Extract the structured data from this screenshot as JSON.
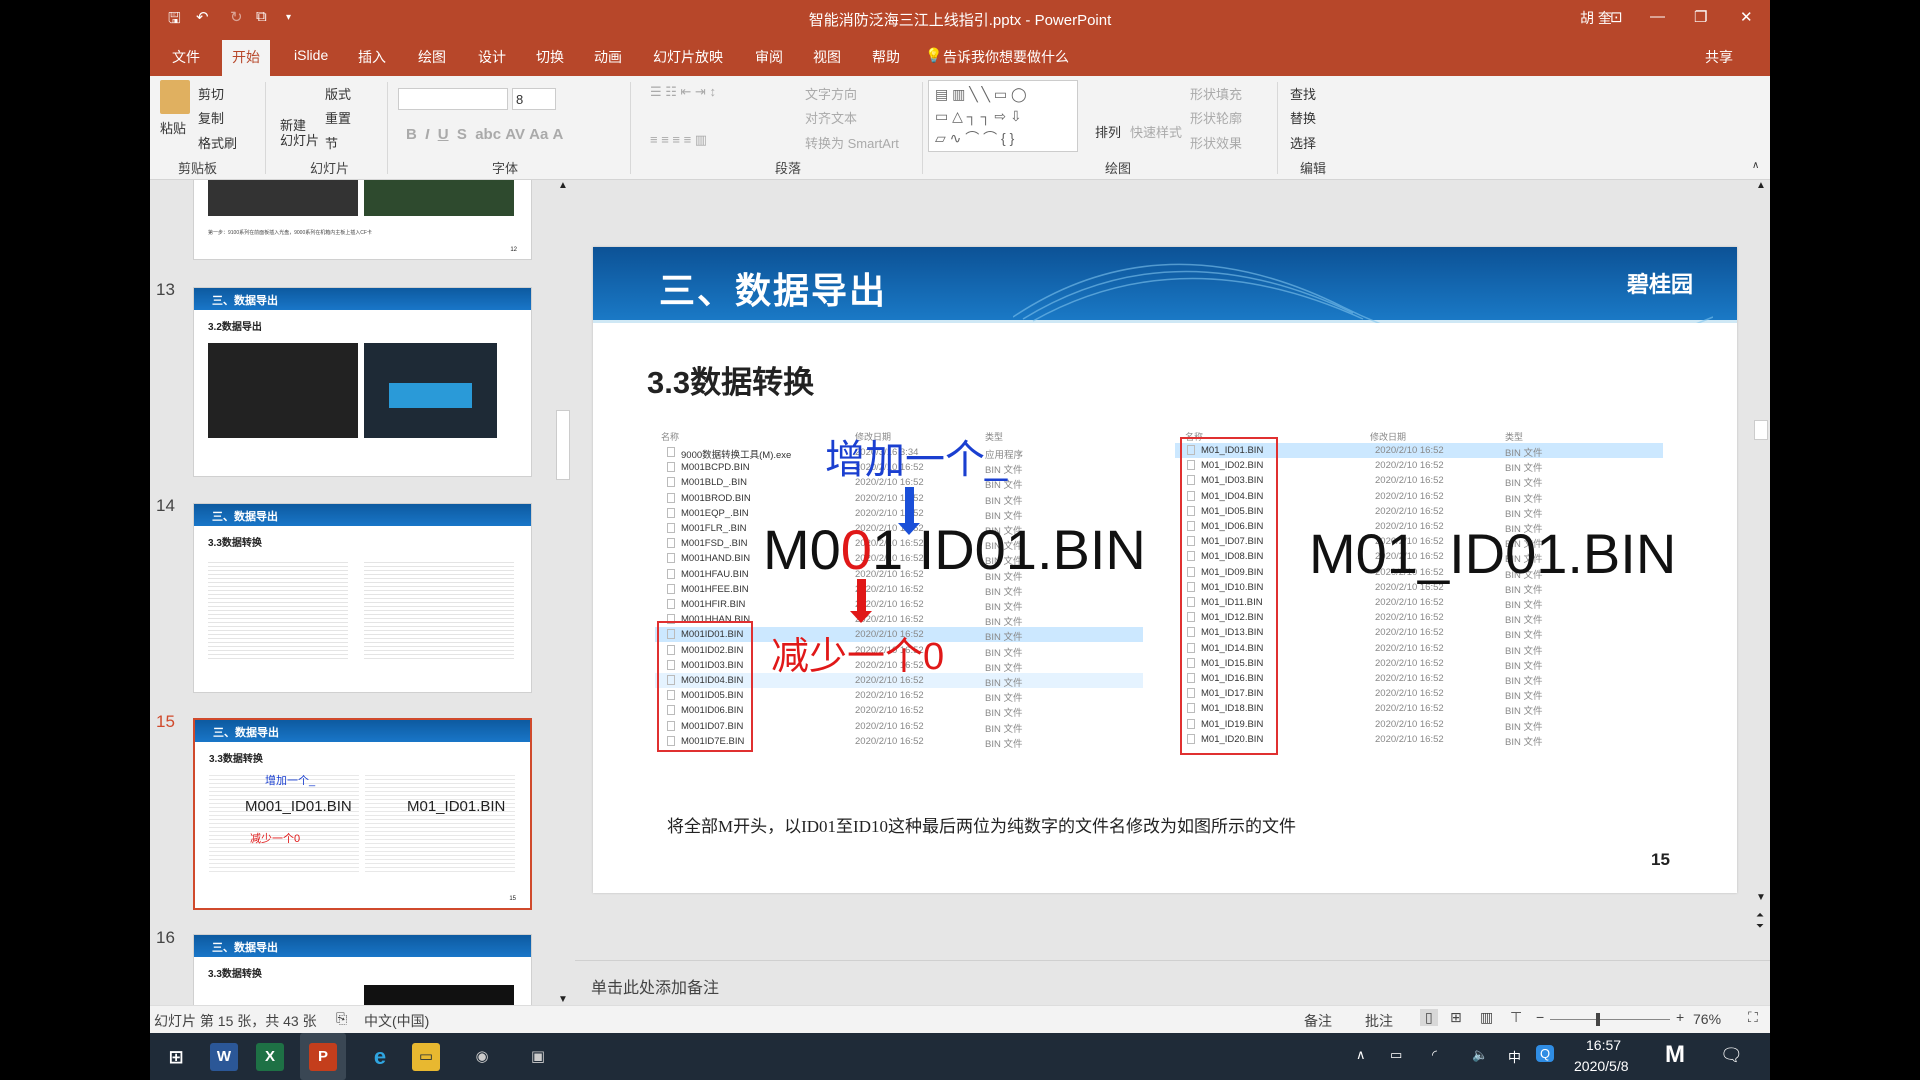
{
  "window": {
    "title": "智能消防泛海三江上线指引.pptx  -  PowerPoint",
    "user": "胡 奎",
    "controls": [
      "minimize",
      "restore",
      "close"
    ]
  },
  "tabs": [
    {
      "label": "文件"
    },
    {
      "label": "开始",
      "active": true
    },
    {
      "label": "iSlide"
    },
    {
      "label": "插入"
    },
    {
      "label": "绘图"
    },
    {
      "label": "设计"
    },
    {
      "label": "切换"
    },
    {
      "label": "动画"
    },
    {
      "label": "幻灯片放映"
    },
    {
      "label": "审阅"
    },
    {
      "label": "视图"
    },
    {
      "label": "帮助"
    }
  ],
  "tell_me": "告诉我你想要做什么",
  "share": "共享",
  "ribbon": {
    "clipboard": {
      "paste": "粘贴",
      "cut": "剪切",
      "copy": "复制",
      "format_painter": "格式刷",
      "group": "剪贴板"
    },
    "slides": {
      "new_slide": "新建\n幻灯片",
      "layout": "版式",
      "reset": "重置",
      "section": "节",
      "group": "幻灯片"
    },
    "font": {
      "font_size": "8",
      "group": "字体"
    },
    "paragraph": {
      "text_direction": "文字方向",
      "align_text": "对齐文本",
      "smartart": "转换为 SmartArt",
      "group": "段落"
    },
    "drawing": {
      "arrange": "排列",
      "quick_styles": "快速样式",
      "shape_fill": "形状填充",
      "shape_outline": "形状轮廓",
      "shape_effects": "形状效果",
      "group": "绘图"
    },
    "editing": {
      "find": "查找",
      "replace": "替换",
      "select": "选择",
      "group": "编辑"
    }
  },
  "thumbnails": [
    {
      "num": "",
      "title": "",
      "subtitle": "",
      "page": "12",
      "caption": "第一步：9100系列在前面板插入光盘，9000系列在机箱内主板上插入CF卡"
    },
    {
      "num": "13",
      "title": "三、数据导出",
      "subtitle": "3.2数据导出",
      "page": "13"
    },
    {
      "num": "14",
      "title": "三、数据导出",
      "subtitle": "3.3数据转换",
      "page": "14"
    },
    {
      "num": "15",
      "title": "三、数据导出",
      "subtitle": "3.3数据转换",
      "page": "15",
      "selected": true,
      "overlay_left": "M001_ID01.BIN",
      "overlay_right": "M01_ID01.BIN",
      "add": "增加一个_",
      "reduce": "减少一个0"
    },
    {
      "num": "16",
      "title": "三、数据导出",
      "subtitle": "3.3数据转换"
    }
  ],
  "slide": {
    "header": "三、数据导出",
    "logo": "碧桂园",
    "subtitle": "3.3数据转换",
    "caption": "将全部M开头，以ID01至ID10这种最后两位为纯数字的文件名修改为如图所示的文件",
    "page_number": "15",
    "annot_add": "增加一个_",
    "annot_reduce": "减少一个0",
    "big_left": {
      "pre": "M0",
      "red": "0",
      "post": "1 ID01.BIN"
    },
    "big_right": "M01_ID01.BIN",
    "left_explorer": {
      "headers": [
        "名称",
        "修改日期",
        "类型"
      ],
      "rows": [
        [
          "9000数据转换工具(M).exe",
          "2020/3/16 3:34",
          "应用程序"
        ],
        [
          "M001BCPD.BIN",
          "2020/2/10 16:52",
          "BIN 文件"
        ],
        [
          "M001BLD_.BIN",
          "2020/2/10 16:52",
          "BIN 文件"
        ],
        [
          "M001BROD.BIN",
          "2020/2/10 16:52",
          "BIN 文件"
        ],
        [
          "M001EQP_.BIN",
          "2020/2/10 16:52",
          "BIN 文件"
        ],
        [
          "M001FLR_.BIN",
          "2020/2/10 16:52",
          "BIN 文件"
        ],
        [
          "M001FSD_.BIN",
          "2020/2/10 16:52",
          "BIN 文件"
        ],
        [
          "M001HAND.BIN",
          "2020/2/10 16:52",
          "BIN 文件"
        ],
        [
          "M001HFAU.BIN",
          "2020/2/10 16:52",
          "BIN 文件"
        ],
        [
          "M001HFEE.BIN",
          "2020/2/10 16:52",
          "BIN 文件"
        ],
        [
          "M001HFIR.BIN",
          "2020/2/10 16:52",
          "BIN 文件"
        ],
        [
          "M001HHAN.BIN",
          "2020/2/10 16:52",
          "BIN 文件"
        ],
        [
          "M001ID01.BIN",
          "2020/2/10 16:52",
          "BIN 文件"
        ],
        [
          "M001ID02.BIN",
          "2020/2/10 16:52",
          "BIN 文件"
        ],
        [
          "M001ID03.BIN",
          "2020/2/10 16:52",
          "BIN 文件"
        ],
        [
          "M001ID04.BIN",
          "2020/2/10 16:52",
          "BIN 文件"
        ],
        [
          "M001ID05.BIN",
          "2020/2/10 16:52",
          "BIN 文件"
        ],
        [
          "M001ID06.BIN",
          "2020/2/10 16:52",
          "BIN 文件"
        ],
        [
          "M001ID07.BIN",
          "2020/2/10 16:52",
          "BIN 文件"
        ],
        [
          "M001ID7E.BIN",
          "2020/2/10 16:52",
          "BIN 文件"
        ]
      ],
      "selected_row": 12,
      "hover_row": 15
    },
    "right_explorer": {
      "headers": [
        "名称",
        "修改日期",
        "类型"
      ],
      "rows": [
        [
          "M01_ID01.BIN"
        ],
        [
          "M01_ID02.BIN"
        ],
        [
          "M01_ID03.BIN"
        ],
        [
          "M01_ID04.BIN"
        ],
        [
          "M01_ID05.BIN"
        ],
        [
          "M01_ID06.BIN"
        ],
        [
          "M01_ID07.BIN"
        ],
        [
          "M01_ID08.BIN"
        ],
        [
          "M01_ID09.BIN"
        ],
        [
          "M01_ID10.BIN"
        ],
        [
          "M01_ID11.BIN"
        ],
        [
          "M01_ID12.BIN"
        ],
        [
          "M01_ID13.BIN"
        ],
        [
          "M01_ID14.BIN"
        ],
        [
          "M01_ID15.BIN"
        ],
        [
          "M01_ID16.BIN"
        ],
        [
          "M01_ID17.BIN"
        ],
        [
          "M01_ID18.BIN"
        ],
        [
          "M01_ID19.BIN"
        ],
        [
          "M01_ID20.BIN"
        ]
      ],
      "date": "2020/2/10 16:52",
      "type": "BIN 文件",
      "selected_row": 0
    }
  },
  "notes_placeholder": "单击此处添加备注",
  "status": {
    "slide_info": "幻灯片 第 15 张，共 43 张",
    "language": "中文(中国)",
    "notes": "备注",
    "comments": "批注",
    "zoom": "76%",
    "zoom_level": 76
  },
  "taskbar": {
    "time": "16:57",
    "date": "2020/5/8",
    "ime": "中",
    "apps": [
      "windows-start",
      "word",
      "excel",
      "powerpoint",
      "edge",
      "file-explorer",
      "app-1",
      "app-2"
    ]
  },
  "colors": {
    "accent": "#b7472a",
    "slide_header": "#1468b4",
    "annot_blue": "#1a3fd0",
    "annot_red": "#e01818"
  }
}
